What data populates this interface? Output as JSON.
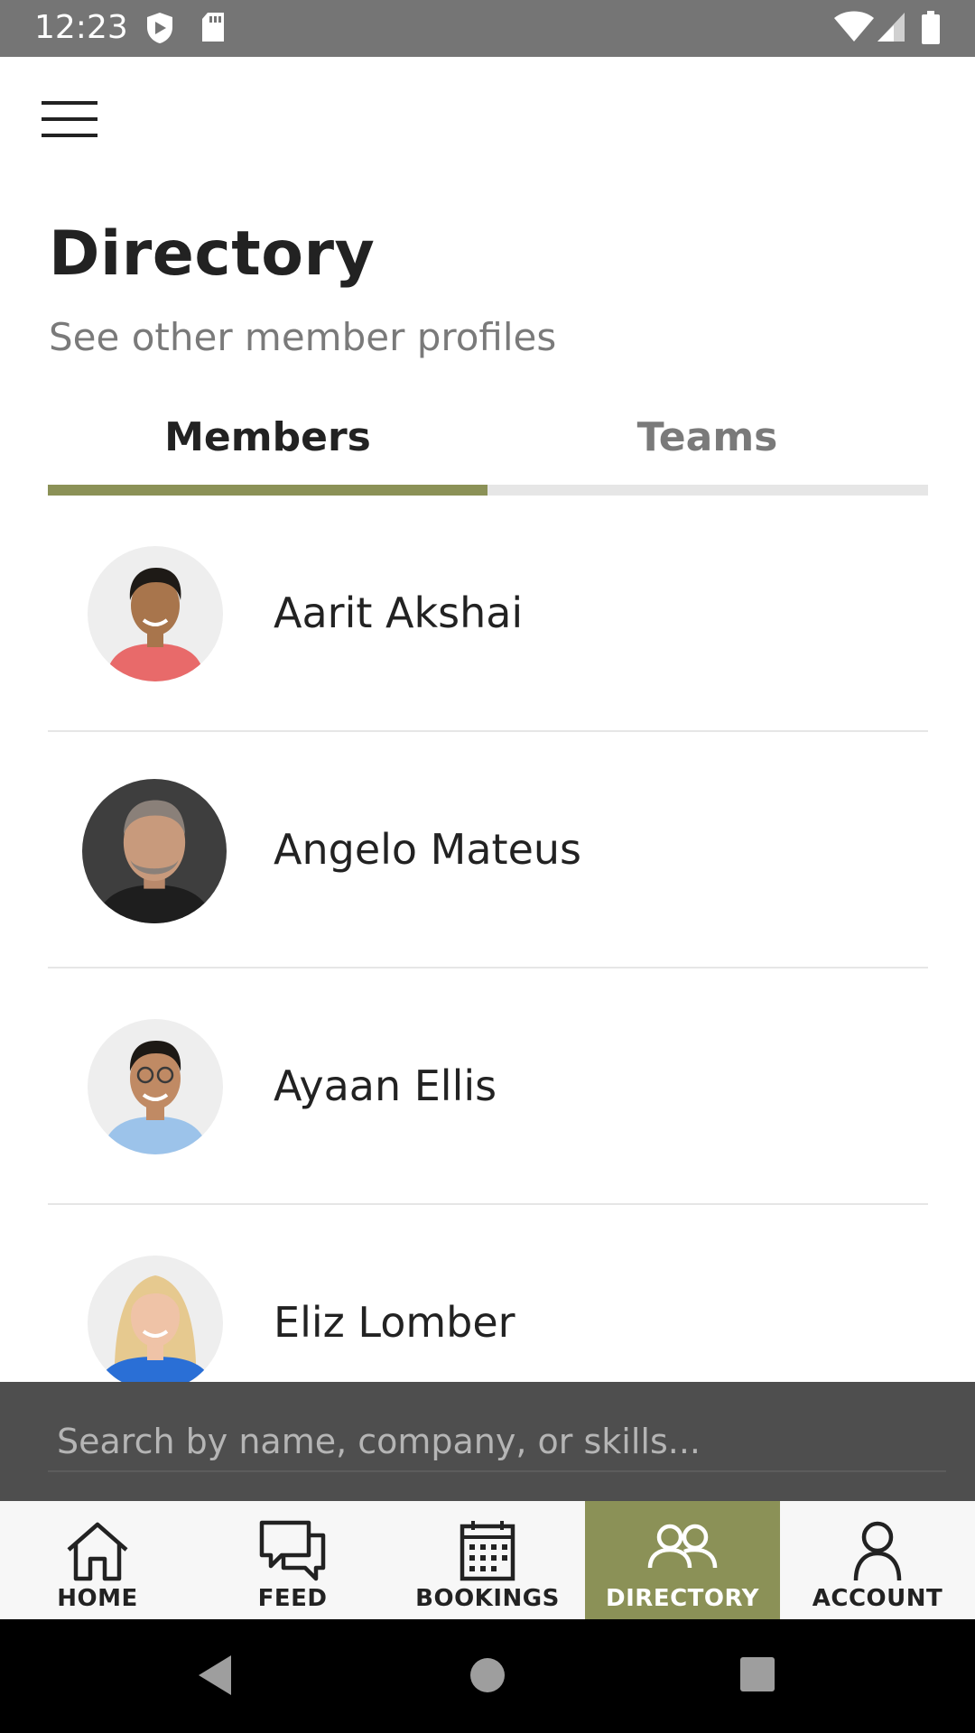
{
  "status_bar": {
    "time": "12:23",
    "left_icons": [
      "shield-icon",
      "sd-card-icon"
    ],
    "right_icons": [
      "wifi-icon",
      "cell-signal-icon",
      "battery-icon"
    ]
  },
  "header": {
    "menu_icon": "hamburger-icon",
    "title": "Directory",
    "subtitle": "See other member profiles"
  },
  "tabs": [
    {
      "label": "Members",
      "active": true
    },
    {
      "label": "Teams",
      "active": false
    }
  ],
  "members": [
    {
      "name": "Aarit Akshai",
      "avatar_colors": {
        "bg": "#eeeeee",
        "skin": "#a8754c",
        "hair": "#1e1a16",
        "shirt": "#e86a6a"
      }
    },
    {
      "name": "Angelo Mateus",
      "avatar_colors": {
        "bg": "#3e3e3e",
        "skin": "#c89a7c",
        "hair": "#8a8079",
        "shirt": "#1e1e1e"
      }
    },
    {
      "name": "Ayaan Ellis",
      "avatar_colors": {
        "bg": "#eeeeee",
        "skin": "#c08a64",
        "hair": "#1d1915",
        "shirt": "#9cc3ea"
      }
    },
    {
      "name": "Eliz Lomber",
      "avatar_colors": {
        "bg": "#eeeeee",
        "skin": "#efc3a7",
        "hair": "#e6c98f",
        "shirt": "#2a6fd6"
      }
    }
  ],
  "search": {
    "placeholder": "Search by name, company, or skills..."
  },
  "bottom_nav": [
    {
      "label": "HOME",
      "icon": "home-icon",
      "active": false
    },
    {
      "label": "FEED",
      "icon": "chat-bubbles-icon",
      "active": false
    },
    {
      "label": "BOOKINGS",
      "icon": "calendar-icon",
      "active": false
    },
    {
      "label": "DIRECTORY",
      "icon": "people-icon",
      "active": true
    },
    {
      "label": "ACCOUNT",
      "icon": "person-icon",
      "active": false
    }
  ],
  "colors": {
    "accent": "#8b9157",
    "status_bar": "#757575",
    "search_overlay": "#4e4e4e",
    "divider": "#e6e6e6"
  }
}
